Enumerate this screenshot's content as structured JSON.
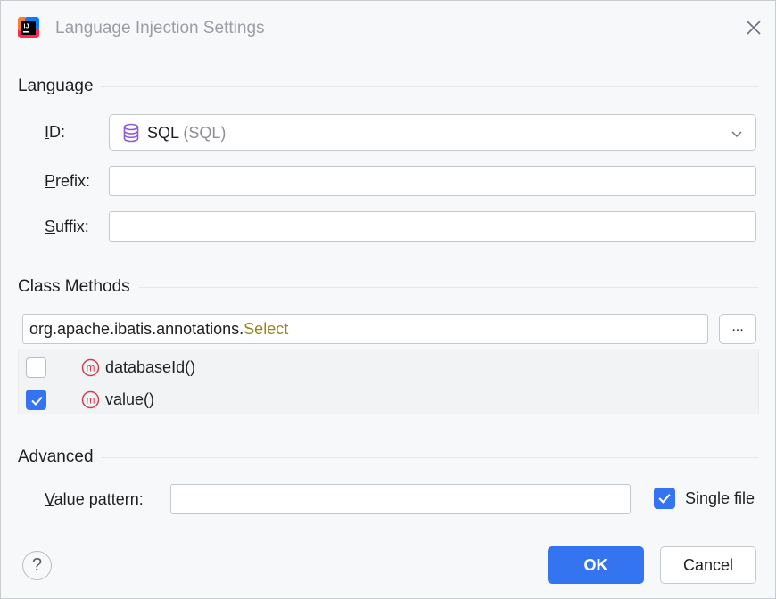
{
  "window": {
    "title": "Language Injection Settings",
    "app_icon": "intellij-idea-icon",
    "close_icon": "close-icon"
  },
  "language": {
    "section_title": "Language",
    "id_label_mnemonic": "I",
    "id_label_rest": "D:",
    "id_value": "SQL",
    "id_value_hint": "(SQL)",
    "id_icon": "database-icon",
    "prefix_label_mnemonic": "P",
    "prefix_label_rest": "refix:",
    "prefix_value": "",
    "suffix_label_mnemonic": "S",
    "suffix_label_rest": "uffix:",
    "suffix_value": ""
  },
  "class_methods": {
    "section_title": "Class Methods",
    "class_package": "org.apache.ibatis.annotations.",
    "class_name": "Select",
    "browse_label": "...",
    "methods": [
      {
        "name": "databaseId()",
        "checked": false
      },
      {
        "name": "value()",
        "checked": true
      }
    ]
  },
  "advanced": {
    "section_title": "Advanced",
    "value_pattern_label_mnemonic": "V",
    "value_pattern_label_rest": "alue pattern:",
    "value_pattern_value": "",
    "single_file_label_mnemonic": "S",
    "single_file_label_rest": "ingle file",
    "single_file_checked": true
  },
  "footer": {
    "help_label": "?",
    "ok_label": "OK",
    "cancel_label": "Cancel"
  },
  "colors": {
    "accent": "#3574f0",
    "class_name": "#958522",
    "method_icon": "#d13d52",
    "database_icon": "#8e5bd6"
  }
}
